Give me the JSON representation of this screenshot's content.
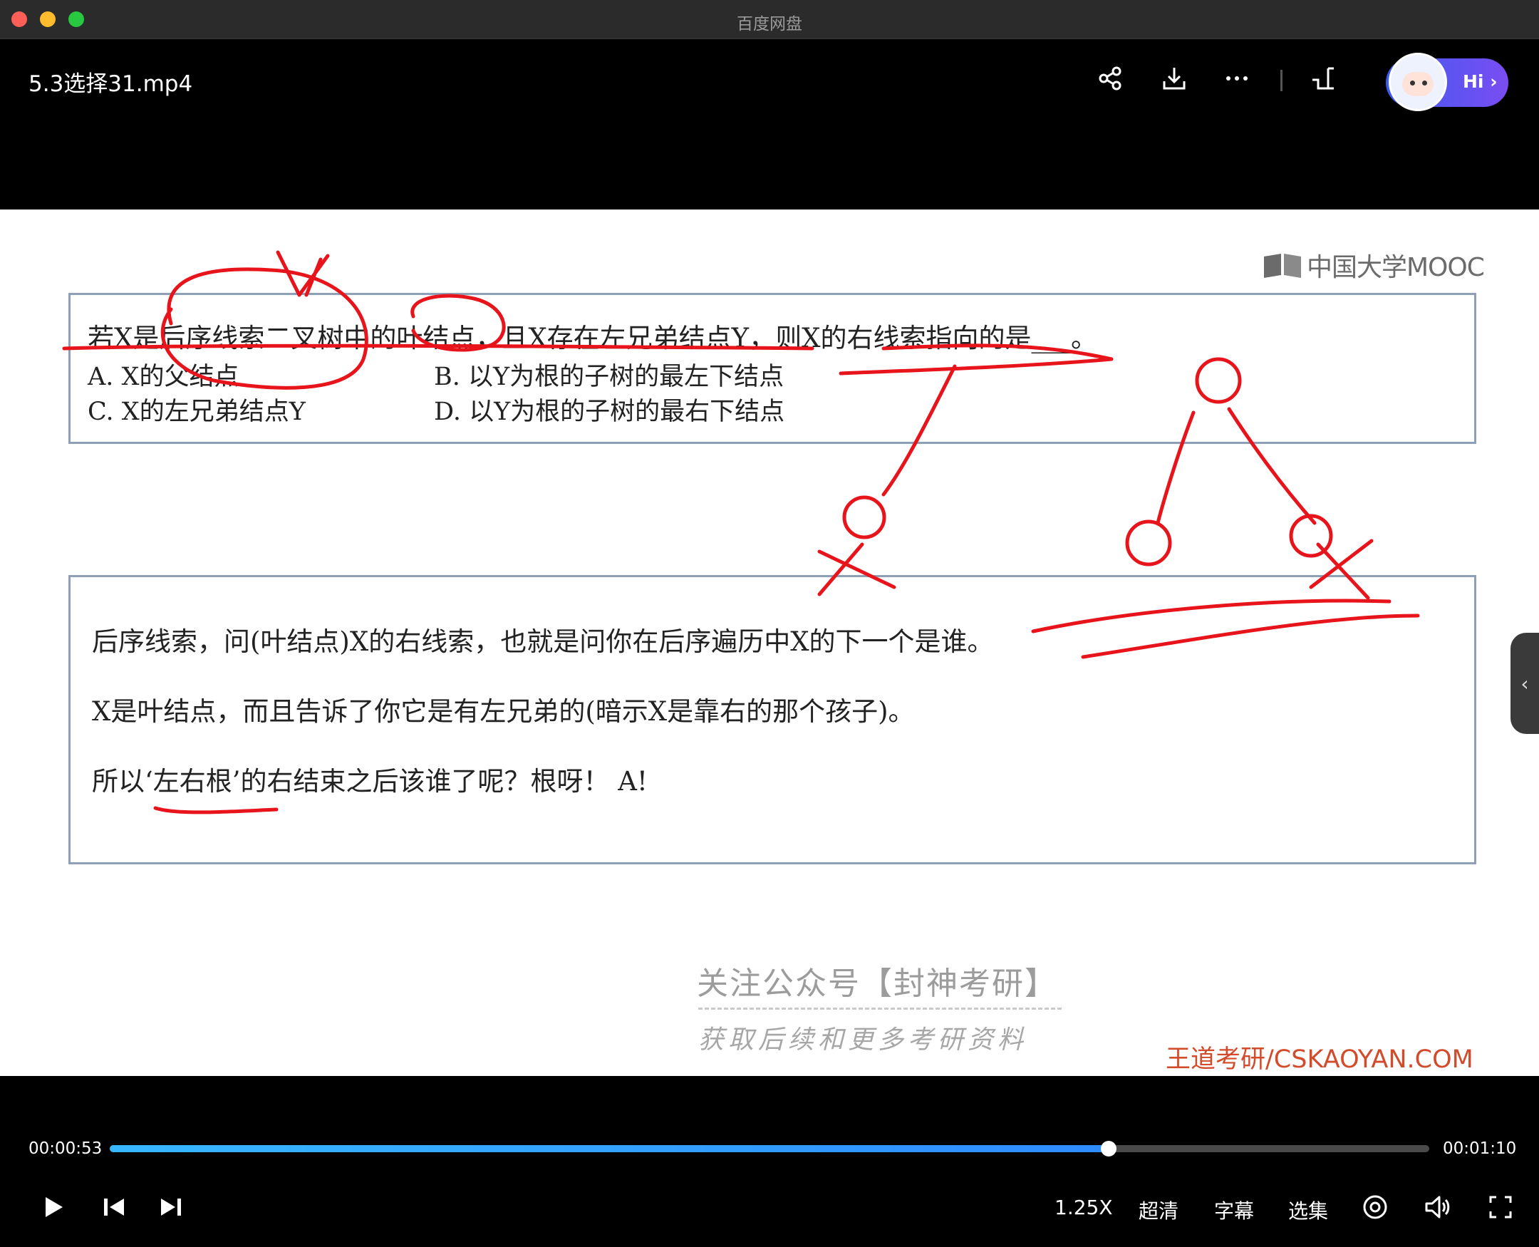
{
  "window": {
    "title": "百度网盘"
  },
  "player": {
    "filename": "5.3选择31.mp4",
    "hi_label": "Hi ›"
  },
  "slide": {
    "mooc_logo": "中国大学MOOC",
    "question": "若X是后序线索二叉树中的叶结点，且X存在左兄弟结点Y，则X的右线索指向的是___。",
    "options": {
      "a": "A. X的父结点",
      "b": "B. 以Y为根的子树的最左下结点",
      "c": "C. X的左兄弟结点Y",
      "d": "D. 以Y为根的子树的最右下结点"
    },
    "answer_lines": [
      "后序线索，问(叶结点)X的右线索，也就是问你在后序遍历中X的下一个是谁。",
      "X是叶结点，而且告诉了你它是有左兄弟的(暗示X是靠右的那个孩子)。",
      "所以‘左右根’的右结束之后该谁了呢？根呀！ A!"
    ],
    "watermark_1": "关注公众号【封神考研】",
    "watermark_2": "获取后续和更多考研资料",
    "brand": "王道考研/CSKAOYAN.COM"
  },
  "controls": {
    "current_time": "00:00:53",
    "total_time": "00:01:10",
    "progress_fraction": 0.757,
    "speed": "1.25X",
    "quality": "超清",
    "subtitles": "字幕",
    "episodes": "选集"
  },
  "colors": {
    "accent": "#2f8cff",
    "ink": "#e8141b"
  }
}
